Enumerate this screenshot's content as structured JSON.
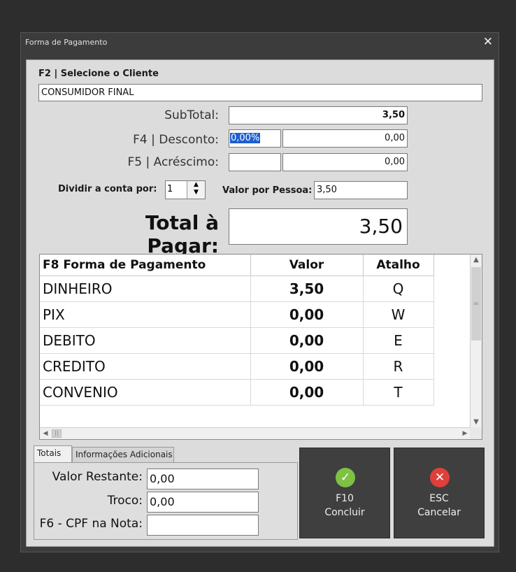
{
  "window": {
    "title": "Forma de Pagamento",
    "close_label": "✕"
  },
  "client": {
    "label": "F2 | Selecione o Cliente",
    "value": "CONSUMIDOR FINAL"
  },
  "subtotal": {
    "label": "SubTotal:",
    "value": "3,50"
  },
  "discount": {
    "label": "F4 | Desconto:",
    "percent": "0,00%",
    "value": "0,00"
  },
  "surcharge": {
    "label": "F5 | Acréscimo:",
    "percent": "",
    "value": "0,00"
  },
  "split": {
    "label": "Dividir a conta por:",
    "value": "1",
    "per_person_label": "Valor por Pessoa:",
    "per_person_value": "3,50"
  },
  "total": {
    "label": "Total à Pagar:",
    "value": "3,50"
  },
  "grid": {
    "headers": [
      "F8 Forma de Pagamento",
      "Valor",
      "Atalho"
    ],
    "rows": [
      {
        "name": "DINHEIRO",
        "value": "3,50",
        "key": "Q"
      },
      {
        "name": "PIX",
        "value": "0,00",
        "key": "W"
      },
      {
        "name": "DEBITO",
        "value": "0,00",
        "key": "E"
      },
      {
        "name": "CREDITO",
        "value": "0,00",
        "key": "R"
      },
      {
        "name": "CONVENIO",
        "value": "0,00",
        "key": "T"
      }
    ]
  },
  "tabs": {
    "items": [
      "Totais",
      "Informações Adicionais"
    ],
    "active": "Totais"
  },
  "totals": {
    "remaining_label": "Valor Restante:",
    "remaining_value": "0,00",
    "change_label": "Troco:",
    "change_value": "0,00",
    "cpf_label": "F6 - CPF na Nota:",
    "cpf_value": ""
  },
  "buttons": {
    "conclude": {
      "key": "F10",
      "label": "Concluir",
      "icon": "check-icon",
      "color": "#7dc242"
    },
    "cancel": {
      "key": "ESC",
      "label": "Cancelar",
      "icon": "cancel-icon",
      "color": "#e0403a"
    }
  }
}
